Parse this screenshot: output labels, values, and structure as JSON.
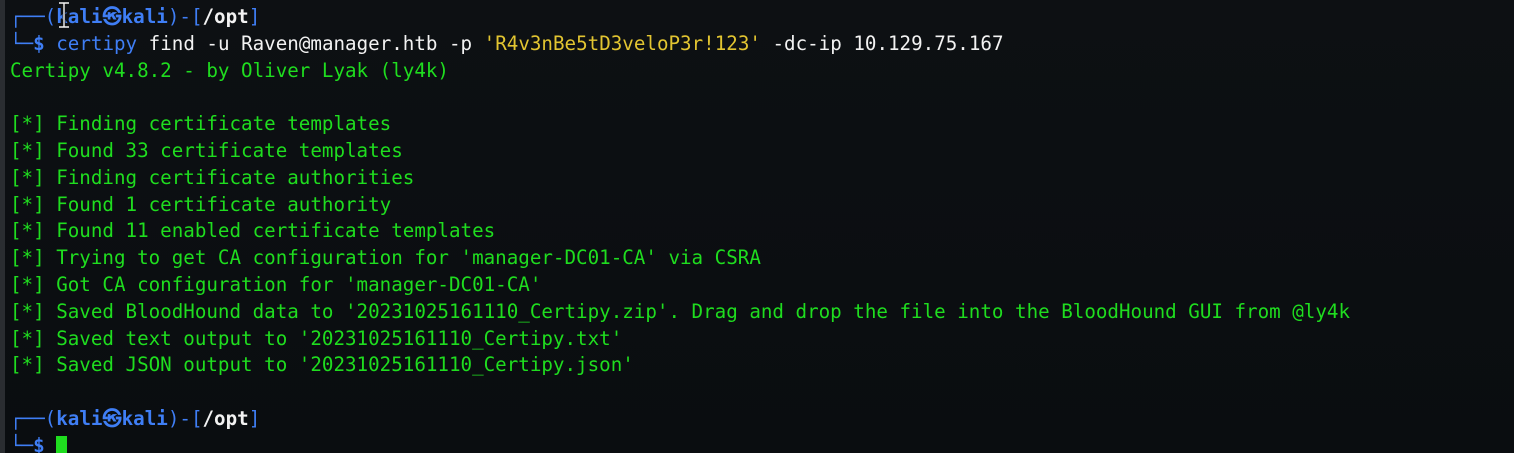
{
  "prompt": {
    "open": "┌──(",
    "user": "kali",
    "at": "㉿",
    "host": "kali",
    "mid": ")-[",
    "path": "/opt",
    "close": "]",
    "line2_prefix": "└─",
    "dollar": "$"
  },
  "command": {
    "name": "certipy",
    "args": " find -u Raven@manager.htb -p ",
    "password": "'R4v3nBe5tD3veloP3r!123'",
    "tail": " -dc-ip 10.129.75.167"
  },
  "output": {
    "banner": "Certipy v4.8.2 - by Oliver Lyak (ly4k)",
    "lines": [
      "[*] Finding certificate templates",
      "[*] Found 33 certificate templates",
      "[*] Finding certificate authorities",
      "[*] Found 1 certificate authority",
      "[*] Found 11 enabled certificate templates",
      "[*] Trying to get CA configuration for 'manager-DC01-CA' via CSRA",
      "[*] Got CA configuration for 'manager-DC01-CA'",
      "[*] Saved BloodHound data to '20231025161110_Certipy.zip'. Drag and drop the file into the BloodHound GUI from @ly4k",
      "[*] Saved text output to '20231025161110_Certipy.txt'",
      "[*] Saved JSON output to '20231025161110_Certipy.json'"
    ]
  },
  "colors": {
    "background": "#0c0f12",
    "prompt_blue": "#3f7ef5",
    "output_green": "#1fdd1f",
    "password_yellow": "#e2c531",
    "text_white": "#f2f2f2"
  },
  "icons": {
    "mouse_pointer": "text-cursor-ibeam-icon"
  }
}
